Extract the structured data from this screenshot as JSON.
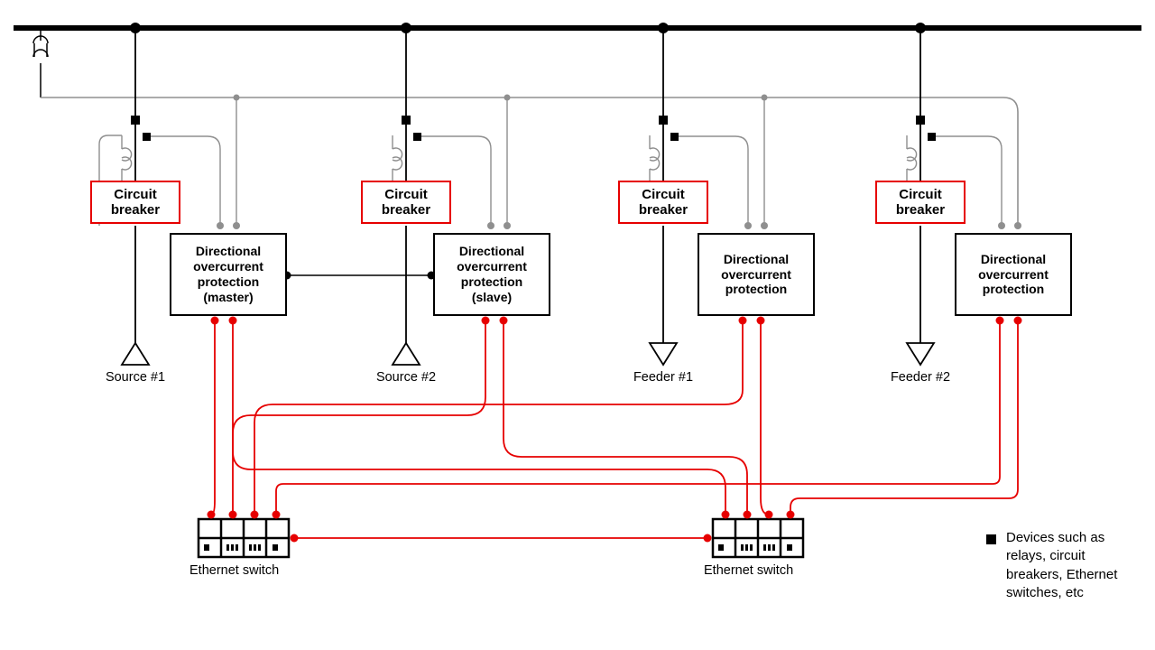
{
  "colors": {
    "red": "#e60000",
    "grey": "#8f8f8f",
    "black": "#000000"
  },
  "busbar": {
    "y": 32
  },
  "bays": [
    {
      "id": "src1",
      "cb": "Circuit\nbreaker",
      "prot": "Directional\novercurrent\nprotection\n(master)",
      "arrow": "up",
      "label": "Source #1"
    },
    {
      "id": "src2",
      "cb": "Circuit\nbreaker",
      "prot": "Directional\novercurrent\nprotection\n(slave)",
      "arrow": "up",
      "label": "Source #2"
    },
    {
      "id": "fd1",
      "cb": "Circuit\nbreaker",
      "prot": "Directional\novercurrent\nprotection",
      "arrow": "down",
      "label": "Feeder #1"
    },
    {
      "id": "fd2",
      "cb": "Circuit\nbreaker",
      "prot": "Directional\novercurrent\nprotection",
      "arrow": "down",
      "label": "Feeder #2"
    }
  ],
  "ethernet": {
    "left_label": "Ethernet switch",
    "right_label": "Ethernet switch"
  },
  "legend": {
    "symbol": "square-icon",
    "text": "Devices such as relays, circuit breakers, Ethernet switches, etc"
  }
}
